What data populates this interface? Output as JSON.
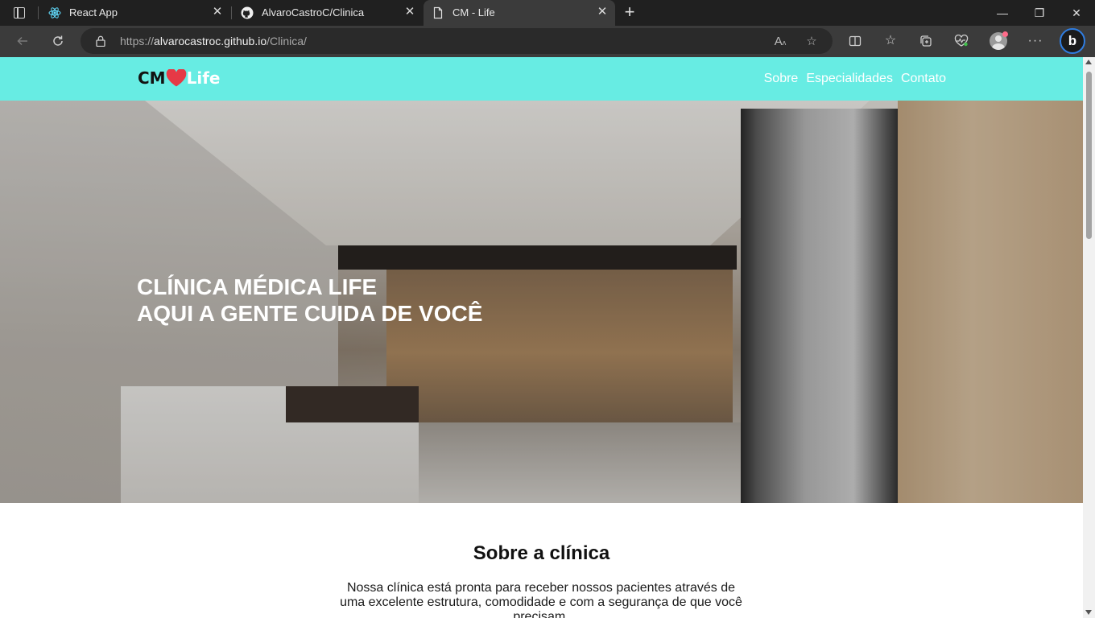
{
  "browser": {
    "tabs": [
      {
        "title": "React App",
        "icon": "react-icon"
      },
      {
        "title": "AlvaroCastroC/Clinica",
        "icon": "github-icon"
      },
      {
        "title": "CM - Life",
        "icon": "page-icon",
        "active": true
      }
    ],
    "url": {
      "scheme": "https://",
      "host": "alvarocastroc.github.io",
      "path": "/Clinica/"
    },
    "window_buttons": {
      "minimize": "—",
      "restore": "❐",
      "close": "✕"
    }
  },
  "site": {
    "logo": {
      "cm": "CM",
      "life": "Life"
    },
    "nav": [
      "Sobre",
      "Especialidades",
      "Contato"
    ],
    "hero": {
      "line1": "CLÍNICA MÉDICA LIFE",
      "line2": "AQUI A GENTE CUIDA DE VOCÊ"
    },
    "about": {
      "title": "Sobre a clínica",
      "text": "Nossa clínica está pronta para receber nossos pacientes através de uma excelente estrutura, comodidade e com a segurança de que você precisam."
    }
  },
  "colors": {
    "header_bg": "#67ece3",
    "logo_heart": "#e63946",
    "chrome_dark": "#202020"
  }
}
